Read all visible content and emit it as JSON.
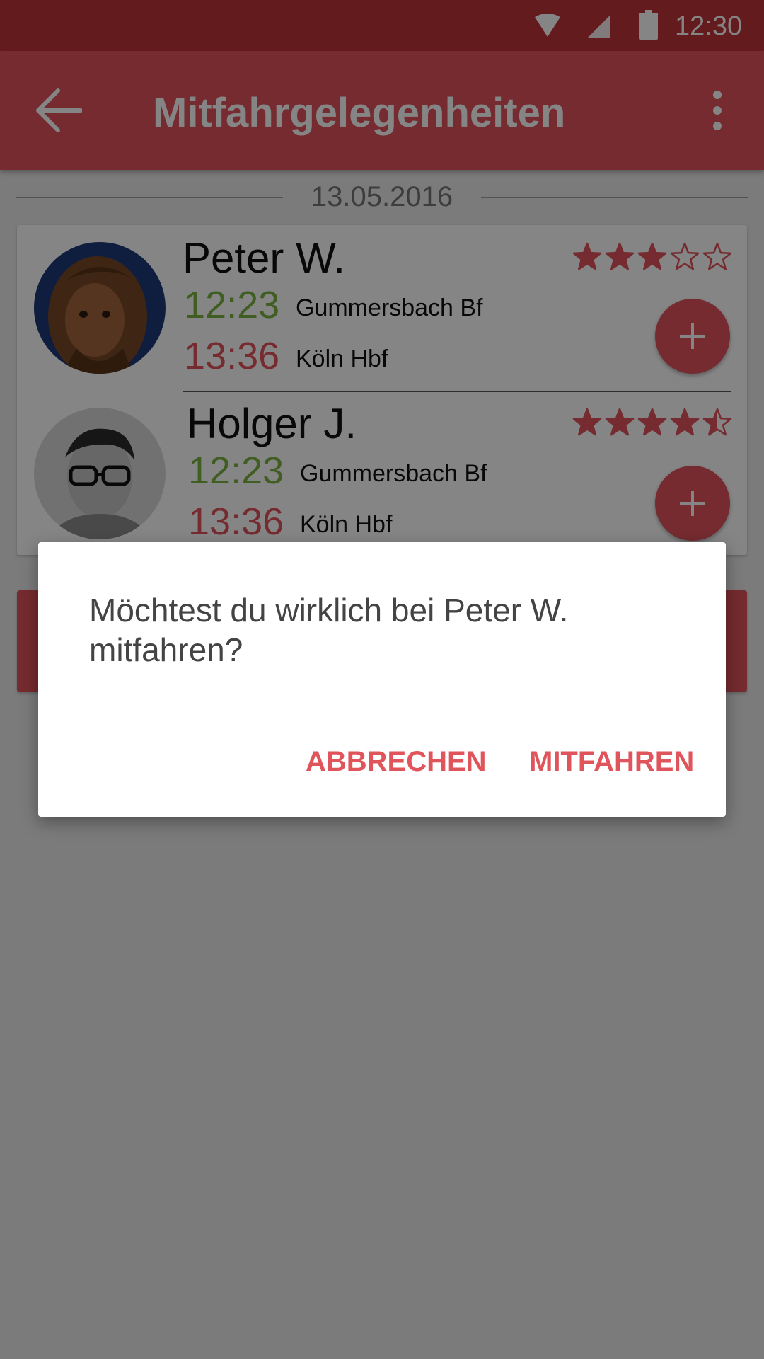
{
  "status_bar": {
    "time": "12:30",
    "icons": [
      "wifi-icon",
      "signal-icon",
      "battery-icon"
    ]
  },
  "toolbar": {
    "title": "Mitfahrgelegenheiten",
    "back_icon": "arrow-back-icon",
    "menu_icon": "more-vert-icon"
  },
  "list": {
    "date": "13.05.2016",
    "rides": [
      {
        "driver": "Peter W.",
        "rating": 3,
        "max_rating": 5,
        "departure_time": "12:23",
        "departure_station": "Gummersbach Bf",
        "arrival_time": "13:36",
        "arrival_station": "Köln Hbf",
        "action_icon": "plus-icon"
      },
      {
        "driver": "Holger J.",
        "rating": 4.5,
        "max_rating": 5,
        "departure_time": "12:23",
        "departure_station": "Gummersbach Bf",
        "arrival_time": "13:36",
        "arrival_station": "Köln Hbf",
        "action_icon": "plus-icon"
      }
    ]
  },
  "dialog": {
    "message": "Möchtest du wirklich bei Peter W. mitfahren?",
    "cancel_label": "ABBRECHEN",
    "confirm_label": "MITFAHREN"
  },
  "colors": {
    "primary": "#e0545b",
    "primary_dark": "#c0353b",
    "departure_time": "#7cb342",
    "arrival_time": "#e0545b",
    "star": "#e0545b"
  }
}
